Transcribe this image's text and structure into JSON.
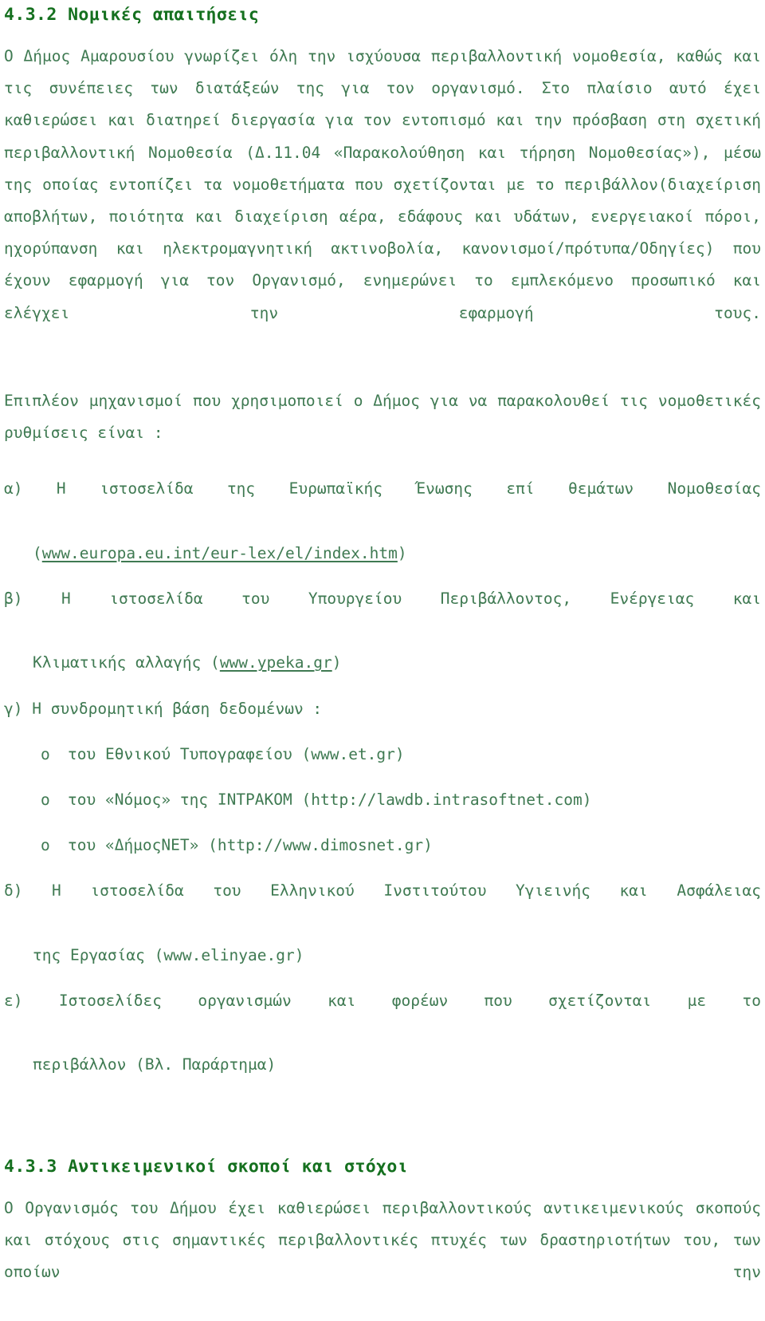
{
  "page": {
    "language": "el",
    "text_color": "#3f7a52",
    "heading_color": "#15701f",
    "background": "#ffffff"
  },
  "sections": [
    {
      "number": "4.3.2",
      "heading": "4.3.2 Νομικές απαιτήσεις",
      "paragraphs": [
        "Ο Δήμος Αμαρουσίου γνωρίζει όλη την ισχύουσα περιβαλλοντική νομοθεσία, καθώς και τις συνέπειες των διατάξεών της για τον οργανισμό. Στο πλαίσιο αυτό έχει καθιερώσει και διατηρεί διεργασία για τον εντοπισμό και την πρόσβαση στη σχετική περιβαλλοντική Νομοθεσία (Δ.11.04 «Παρακολούθηση και τήρηση Νομοθεσίας»), μέσω της οποίας εντοπίζει τα νομοθετήματα που σχετίζονται με το περιβάλλον(διαχείριση αποβλήτων, ποιότητα και διαχείριση αέρα, εδάφους και υδάτων, ενεργειακοί πόροι, ηχορύπανση και ηλεκτρομαγνητική ακτινοβολία, κανονισμοί/πρότυπα/Οδηγίες) που έχουν εφαρμογή για τον Οργανισμό, ενημερώνει το εμπλεκόμενο προσωπικό και ελέγχει την εφαρμογή τους.",
        "Επιπλέον μηχανισμοί που χρησιμοποιεί ο Δήμος για να παρακολουθεί τις νομοθετικές ρυθμίσεις είναι :"
      ]
    }
  ],
  "list_items": [
    {
      "marker": "α)",
      "line1": "α) Η ιστοσελίδα της Ευρωπαϊκής Ένωσης επί θεμάτων Νομοθεσίας",
      "cont_prefix": "(",
      "cont_link": "www.europa.eu.int/eur-lex/el/index.htm",
      "cont_suffix": ")"
    },
    {
      "marker": "β)",
      "line1": "β) Η ιστοσελίδα του Υπουργείου Περιβάλλοντος, Ενέργειας και",
      "cont_prefix": "Κλιματικής αλλαγής (",
      "cont_link": "www.ypeka.gr",
      "cont_suffix": ")"
    },
    {
      "marker": "γ)",
      "line1": "γ) Η συνδρομητική βάση δεδομένων :",
      "cont_prefix": "",
      "cont_link": "",
      "cont_suffix": ""
    }
  ],
  "sub_items": [
    {
      "bullet": "o",
      "text": "του Εθνικού Τυπογραφείου (www.et.gr)"
    },
    {
      "bullet": "o",
      "text": "του «Νόμος» της ΙΝΤΡΑΚΟΜ (http://lawdb.intrasoftnet.com)"
    },
    {
      "bullet": "o",
      "text": "του «ΔήμοςΝΕΤ» (http://www.dimosnet.gr)"
    }
  ],
  "list_items_tail": [
    {
      "marker": "δ)",
      "line1": "δ) Η ιστοσελίδα του Ελληνικού Ινστιτούτου Υγιεινής και Ασφάλειας",
      "cont": "της Εργασίας (www.elinyae.gr)"
    },
    {
      "marker": "ε)",
      "line1": "ε) Ιστοσελίδες οργανισμών και φορέων που σχετίζονται με το",
      "cont": "περιβάλλον (Βλ. Παράρτημα)"
    }
  ],
  "section_2": {
    "number": "4.3.3",
    "heading": "4.3.3 Αντικειμενικοί σκοποί και στόχοι",
    "paragraph": "Ο Οργανισμός του Δήμου έχει καθιερώσει περιβαλλοντικούς αντικειμενικούς σκοπούς και στόχους στις σημαντικές περιβαλλοντικές πτυχές των δραστηριοτήτων του, των οποίων την"
  }
}
